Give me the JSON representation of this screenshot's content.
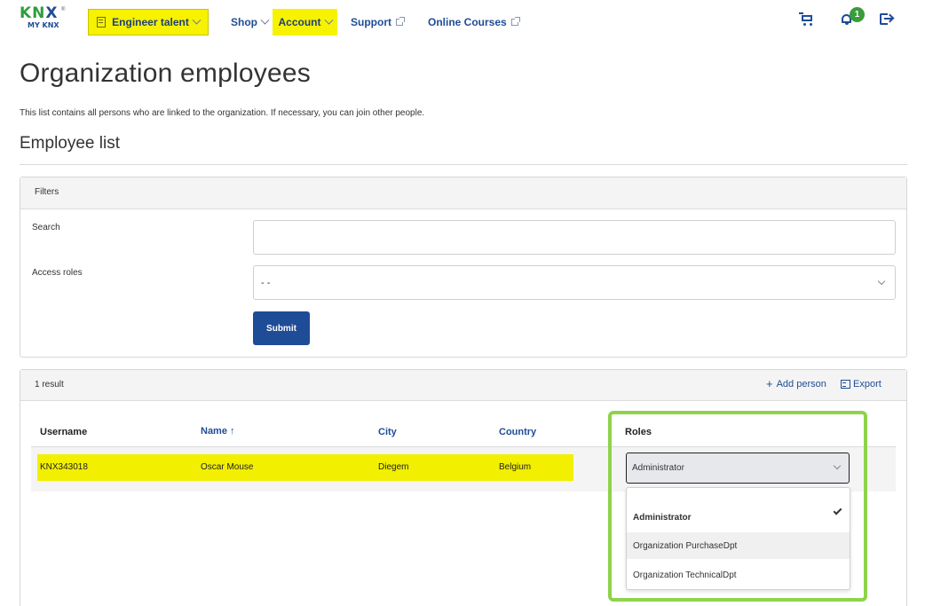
{
  "logo": {
    "mark_k": "KN",
    "mark_x": "X",
    "sub": "MY KNX",
    "reg": "®"
  },
  "nav": {
    "engineer": "Engineer talent",
    "shop": "Shop",
    "account": "Account",
    "support": "Support",
    "courses": "Online Courses",
    "notification_count": "1"
  },
  "page": {
    "title": "Organization employees",
    "description": "This list contains all persons who are linked to the organization. If necessary, you can join other people.",
    "section_title": "Employee list"
  },
  "filters": {
    "header": "Filters",
    "search_label": "Search",
    "search_value": "",
    "roles_label": "Access roles",
    "roles_value": "- -",
    "submit_label": "Submit"
  },
  "results": {
    "count_label": "1 result",
    "add_person_label": "Add person",
    "export_label": "Export",
    "columns": {
      "username": "Username",
      "name": "Name",
      "name_sort": "↑",
      "city": "City",
      "country": "Country",
      "roles": "Roles"
    },
    "rows": [
      {
        "username": "KNX343018",
        "name": "Oscar Mouse",
        "city": "Diegem",
        "country": "Belgium",
        "role": "Administrator"
      }
    ]
  },
  "role_options": [
    {
      "label": "Administrator",
      "selected": true
    },
    {
      "label": "Organization PurchaseDpt",
      "selected": false
    },
    {
      "label": "Organization TechnicalDpt",
      "selected": false
    }
  ],
  "colors": {
    "brand_blue": "#1f4c96",
    "brand_green": "#2e9e3d",
    "highlight_yellow": "#f6f200",
    "annotation_green": "#8ed34a",
    "badge_green": "#3a9c3a"
  }
}
